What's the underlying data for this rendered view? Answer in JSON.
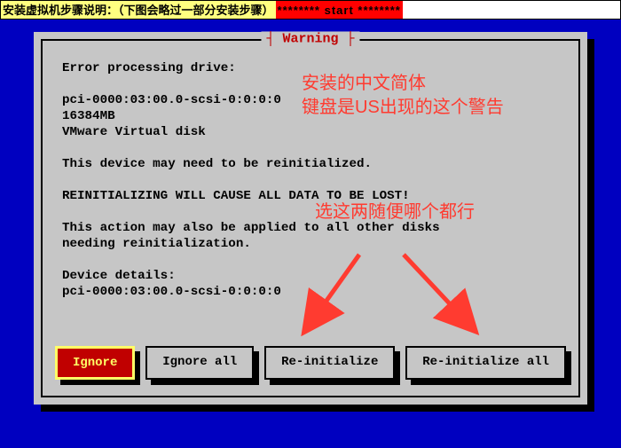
{
  "topbar": {
    "label": "安装虚拟机步骤说明：（下图会略过一部分安装步骤）",
    "start": "******** start ********"
  },
  "dialog": {
    "title_wrapped": "┤ Warning ├",
    "body_lines": [
      "Error processing drive:",
      "",
      "pci-0000:03:00.0-scsi-0:0:0:0",
      "16384MB",
      "VMware Virtual disk",
      "",
      "This device may need to be reinitialized.",
      "",
      "REINITIALIZING WILL CAUSE ALL DATA TO BE LOST!",
      "",
      "This action may also be applied to all other disks",
      "needing reinitialization.",
      "",
      "Device details:",
      "pci-0000:03:00.0-scsi-0:0:0:0"
    ],
    "buttons": {
      "ignore": "Ignore",
      "ignore_all": "Ignore all",
      "reinitialize": "Re-initialize",
      "reinitialize_all": "Re-initialize all"
    }
  },
  "annotations": {
    "line1": "安装的中文简体",
    "line2": "键盘是US出现的这个警告",
    "line3": "选这两随便哪个都行"
  }
}
